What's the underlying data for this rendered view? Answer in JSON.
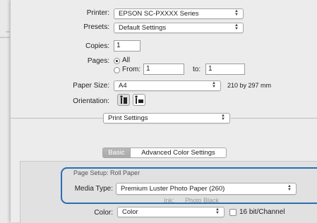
{
  "printer": {
    "label": "Printer:",
    "value": "EPSON SC-PXXXX Series"
  },
  "presets": {
    "label": "Presets:",
    "value": "Default Settings"
  },
  "copies": {
    "label": "Copies:",
    "value": "1"
  },
  "pages": {
    "label": "Pages:",
    "all_label": "All",
    "from_label": "From:",
    "from_value": "1",
    "to_label": "to:",
    "to_value": "1"
  },
  "paper_size": {
    "label": "Paper Size:",
    "value": "A4",
    "dimensions": "210 by 297 mm"
  },
  "orientation": {
    "label": "Orientation:"
  },
  "section_popup": {
    "value": "Print Settings"
  },
  "tabs": {
    "basic": "Basic",
    "advanced": "Advanced Color Settings"
  },
  "page_setup": {
    "text": "Page Setup: Roll Paper"
  },
  "media_type": {
    "label": "Media Type:",
    "value": "Premium Luster Photo Paper (260)"
  },
  "ink_ghost": {
    "label": "Ink:",
    "value": "Photo Black"
  },
  "color": {
    "label": "Color:",
    "value": "Color",
    "bit_label": "16 bit/Channel"
  },
  "colors": {
    "highlight": "#2a6db5"
  }
}
